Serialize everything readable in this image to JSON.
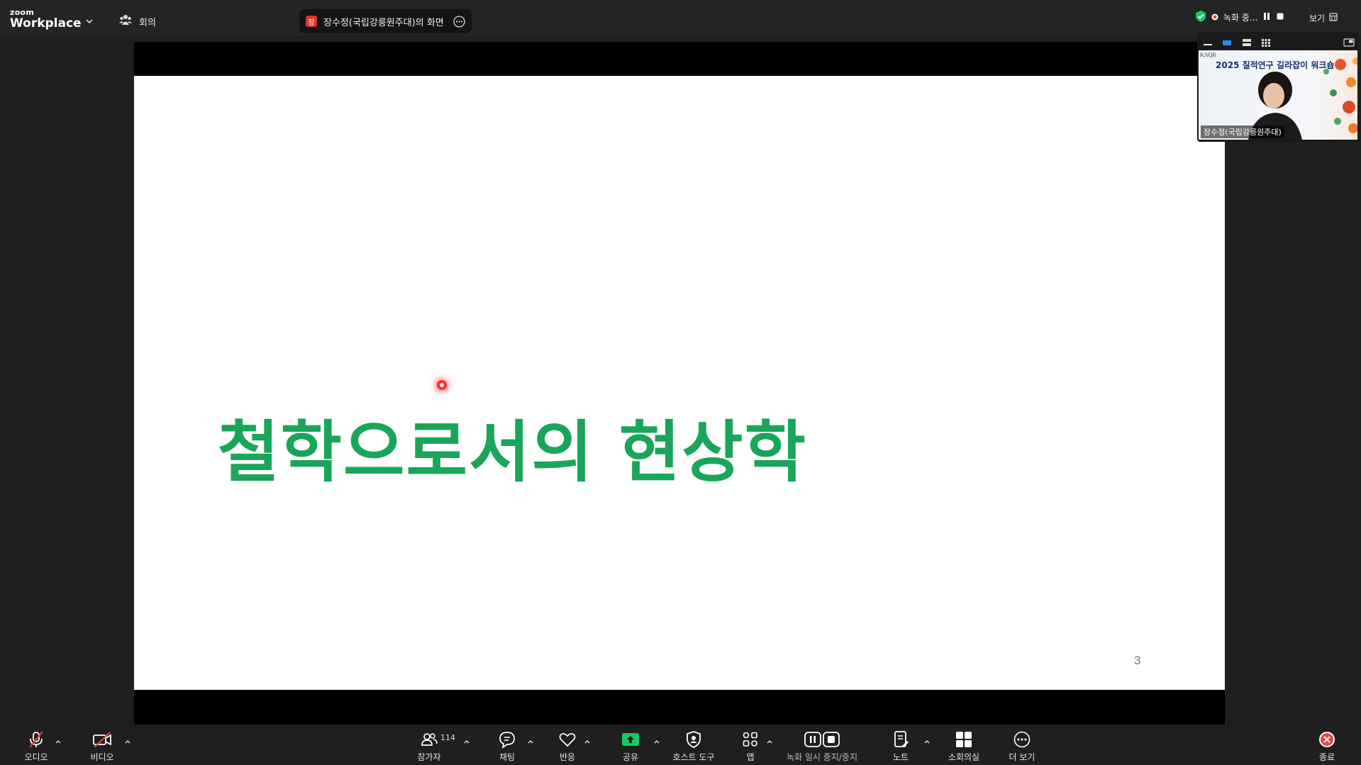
{
  "topbar": {
    "brand_small": "zoom",
    "brand_big": "Workplace",
    "meeting_label": "회의",
    "share_badge": "장",
    "share_label": "장수정(국립강릉원주대)의 화면",
    "recording_status": "녹화 중...",
    "view_label": "보기"
  },
  "slide": {
    "title": "철학으로서의 현상학",
    "page_number": "3",
    "title_color": "#1aa55a"
  },
  "thumbnail": {
    "logo_text": "KAQR",
    "title_text": "2025 질적연구 길라잡이 워크숍",
    "participant_name": "장수정(국립강릉원주대)"
  },
  "toolbar": {
    "audio": "오디오",
    "video": "비디오",
    "participants": "참가자",
    "participant_count": "114",
    "chat": "채팅",
    "reactions": "반응",
    "share": "공유",
    "host_tools": "호스트 도구",
    "apps": "앱",
    "record": "녹화 일시 중지/중지",
    "notes": "노트",
    "breakout": "소회의실",
    "more": "더 보기",
    "end": "종료"
  },
  "colors": {
    "share_green": "#17c964",
    "end_red": "#e8453c",
    "accent_blue": "#2d8cff"
  }
}
